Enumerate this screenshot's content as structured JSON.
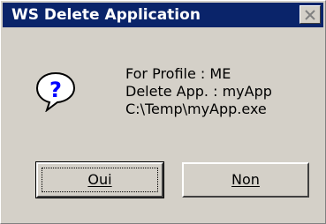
{
  "window": {
    "title": "WS Delete Application"
  },
  "message": {
    "icon": "question-icon",
    "lines": [
      "For Profile : ME",
      "Delete App. : myApp",
      "C:\\Temp\\myApp.exe"
    ]
  },
  "buttons": {
    "yes_label": "Oui",
    "no_label": "Non"
  },
  "colors": {
    "titlebar": "#0a246a",
    "dialog_face": "#d4d0c8",
    "icon_blue": "#0000ff"
  }
}
